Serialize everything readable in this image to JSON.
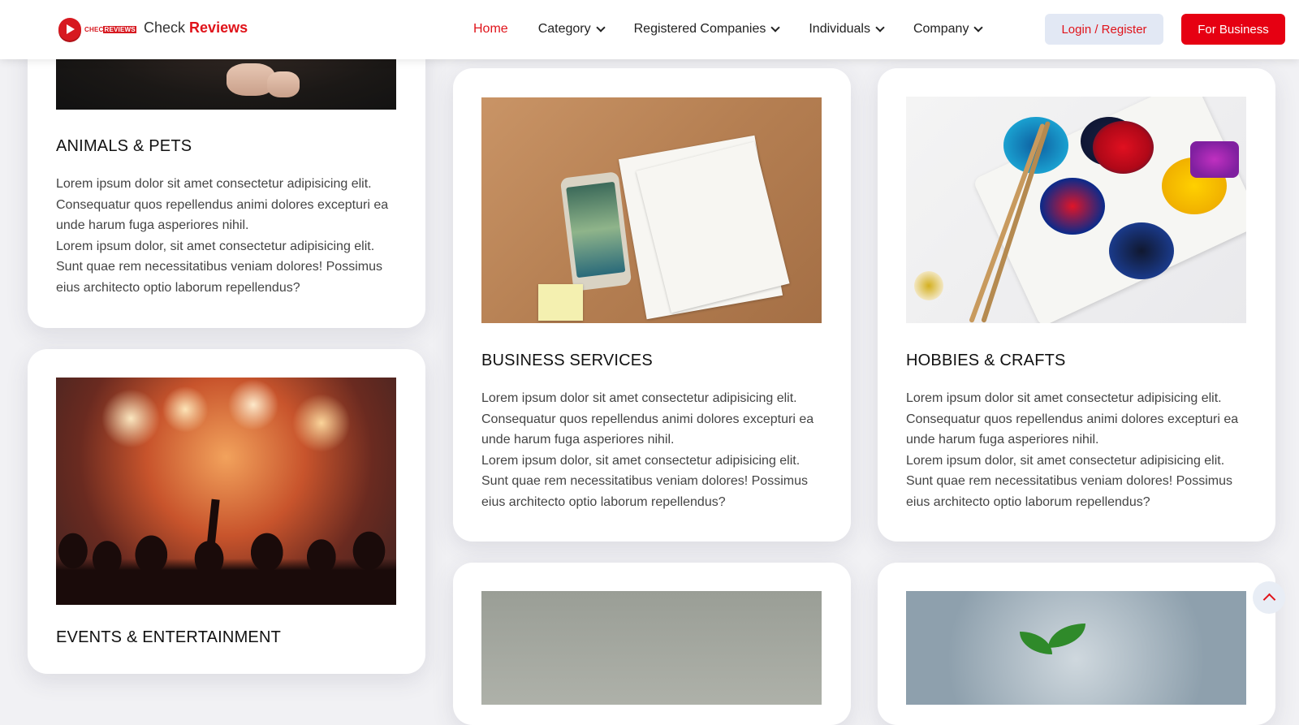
{
  "header": {
    "brand_prefix": "Check",
    "brand_strong": "Reviews",
    "logo_text_a": "CHEC",
    "logo_text_b": "REVIEWS",
    "nav": [
      {
        "label": "Home",
        "active": true
      },
      {
        "label": "Category",
        "dropdown": true
      },
      {
        "label": "Registered Companies",
        "dropdown": true
      },
      {
        "label": "Individuals",
        "dropdown": true
      },
      {
        "label": "Company",
        "dropdown": true
      }
    ],
    "login_label": "Login / Register",
    "business_label": "For Business"
  },
  "cards": [
    {
      "title": "ANIMALS & PETS",
      "p1": "Lorem ipsum dolor sit amet consectetur adipisicing elit. Consequatur quos repellendus animi dolores excepturi ea unde harum fuga asperiores nihil.",
      "p2": "Lorem ipsum dolor, sit amet consectetur adipisicing elit. Sunt quae rem necessitatibus veniam dolores! Possimus eius architecto optio laborum repellendus?"
    },
    {
      "title": "EVENTS & ENTERTAINMENT"
    },
    {
      "title": "BUSINESS SERVICES",
      "p1": "Lorem ipsum dolor sit amet consectetur adipisicing elit. Consequatur quos repellendus animi dolores excepturi ea unde harum fuga asperiores nihil.",
      "p2": "Lorem ipsum dolor, sit amet consectetur adipisicing elit. Sunt quae rem necessitatibus veniam dolores! Possimus eius architecto optio laborum repellendus?"
    },
    {
      "title": "HOBBIES & CRAFTS",
      "p1": "Lorem ipsum dolor sit amet consectetur adipisicing elit. Consequatur quos repellendus animi dolores excepturi ea unde harum fuga asperiores nihil.",
      "p2": "Lorem ipsum dolor, sit amet consectetur adipisicing elit. Sunt quae rem necessitatibus veniam dolores! Possimus eius architecto optio laborum repellendus?"
    }
  ],
  "colors": {
    "accent": "#e0131a",
    "business_button": "#e60012",
    "login_button_bg": "#e2e8f4"
  },
  "icons": {
    "scroll_top": "chevron-up-icon",
    "logo": "play-icon",
    "nav_dropdown": "chevron-down-icon"
  }
}
